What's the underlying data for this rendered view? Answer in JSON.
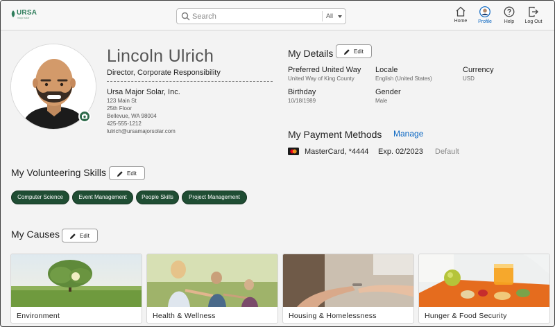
{
  "app": {
    "logo_text": "URSA",
    "logo_subtext": "major solar",
    "brand_color": "#2e7d5b"
  },
  "search": {
    "placeholder": "Search",
    "value": "",
    "scope": "All"
  },
  "nav": [
    {
      "label": "Home",
      "icon": "home-icon"
    },
    {
      "label": "Profile",
      "icon": "profile-icon",
      "active": true
    },
    {
      "label": "Help",
      "icon": "help-icon"
    },
    {
      "label": "Log Out",
      "icon": "logout-icon"
    }
  ],
  "profile": {
    "name": "Lincoln Ulrich",
    "title": "Director, Corporate Responsibility",
    "company": "Ursa Major Solar, Inc.",
    "address": [
      "123 Main St",
      "25th Floor",
      "Bellevue, WA 98004"
    ],
    "phone": "425-555-1212",
    "email": "lulrich@ursamajorsolar.com"
  },
  "details": {
    "heading": "My Details",
    "edit_label": "Edit",
    "fields": [
      {
        "label": "Preferred United Way",
        "value": "United Way of King County"
      },
      {
        "label": "Locale",
        "value": "English (United States)"
      },
      {
        "label": "Currency",
        "value": "USD"
      },
      {
        "label": "Birthday",
        "value": "10/18/1989"
      },
      {
        "label": "Gender",
        "value": "Male"
      }
    ]
  },
  "payment": {
    "heading": "My Payment Methods",
    "manage_label": "Manage",
    "card": "MasterCard, *4444",
    "expiry": "Exp. 02/2023",
    "status": "Default"
  },
  "skills": {
    "heading": "My Volunteering Skills",
    "edit_label": "Edit",
    "items": [
      "Computer Science",
      "Event Management",
      "People Skills",
      "Project Management"
    ],
    "chip_color": "#1f4d33"
  },
  "causes": {
    "heading": "My Causes",
    "edit_label": "Edit",
    "items": [
      "Environment",
      "Health & Wellness",
      "Housing & Homelessness",
      "Hunger & Food Security"
    ]
  }
}
